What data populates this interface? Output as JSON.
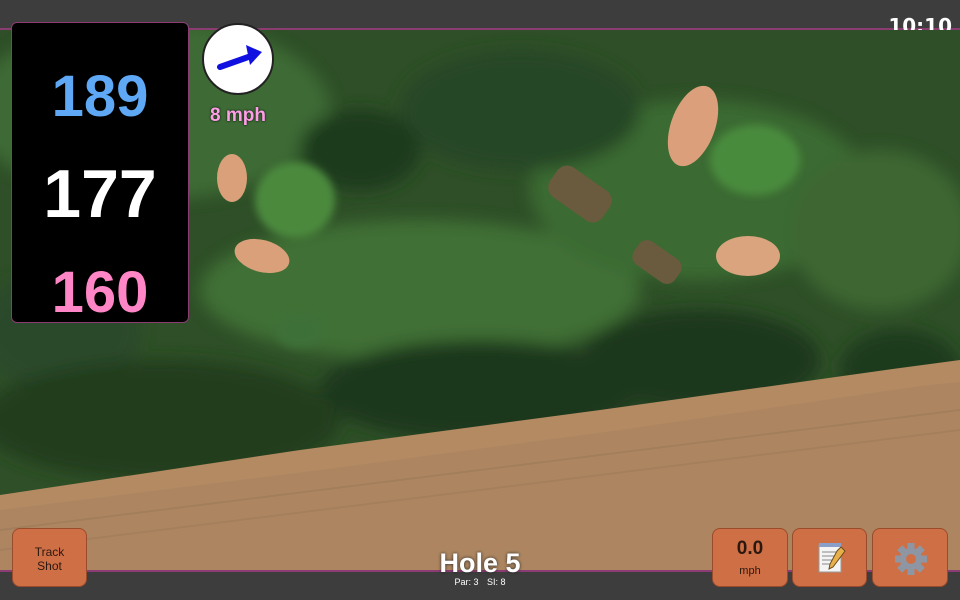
{
  "status": {
    "time": "10:10"
  },
  "distances": {
    "back": "189",
    "middle": "177",
    "front": "160"
  },
  "wind": {
    "speed": "8 mph",
    "arrow_icon": "wind-direction-arrow-icon",
    "arrow_color": "#1010e0"
  },
  "buttons": {
    "track_shot": [
      "Track",
      "Shot"
    ],
    "speed": {
      "value": "0.0",
      "unit": "mph"
    },
    "notes_icon": "notepad-icon",
    "settings_icon": "gear-icon"
  },
  "hole": {
    "title": "Hole 5",
    "par": "Par: 3",
    "si": "SI: 8"
  },
  "colors": {
    "back": "#5fa8f5",
    "middle": "#ffffff",
    "front": "#ff86c6",
    "button": "#cf6f45",
    "accent": "#8a3c73"
  }
}
